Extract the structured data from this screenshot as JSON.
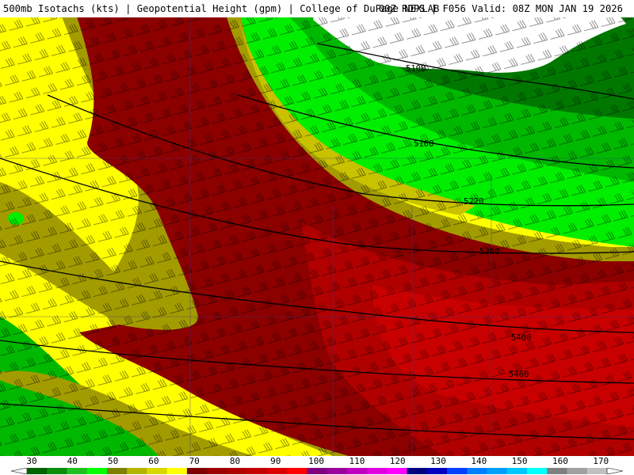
{
  "header": {
    "left": "500mb Isotachs (kts) | Geopotential Height (gpm) | College of DuPage NEXLAB",
    "right": "00Z RDPS | F056 Valid: 08Z MON JAN 19 2026"
  },
  "contours": [
    {
      "label": "5100"
    },
    {
      "label": "5160"
    },
    {
      "label": "5220"
    },
    {
      "label": "5280"
    },
    {
      "label": "5400"
    },
    {
      "label": "5460"
    }
  ],
  "legend": {
    "ticks": [
      "30",
      "40",
      "50",
      "60",
      "70",
      "80",
      "90",
      "100",
      "110",
      "120",
      "130",
      "140",
      "150",
      "160",
      "170"
    ],
    "colors": [
      "#006400",
      "#0c8c0c",
      "#20c020",
      "#00ff00",
      "#808000",
      "#b4b400",
      "#d8d800",
      "#ffff00",
      "#800000",
      "#9c0000",
      "#b00000",
      "#c40000",
      "#dc0000",
      "#ff0000",
      "#800080",
      "#9c009c",
      "#c000c0",
      "#e000e0",
      "#ff00ff",
      "#000080",
      "#0000c0",
      "#0040ff",
      "#0080ff",
      "#00a0ff",
      "#00c8ff",
      "#00ffff",
      "#808080",
      "#a0a0a0",
      "#c0c0c0"
    ]
  },
  "colors": {
    "bg_yellow": "#ffff00",
    "olive": "#a39c00",
    "olive_light": "#c8c200",
    "dark_red": "#8c0000",
    "mid_red": "#b00000",
    "red": "#c80000",
    "green_light": "#00ee00",
    "green": "#00b800",
    "green_dark": "#007800",
    "white": "#ffffff",
    "line": "#000000"
  }
}
